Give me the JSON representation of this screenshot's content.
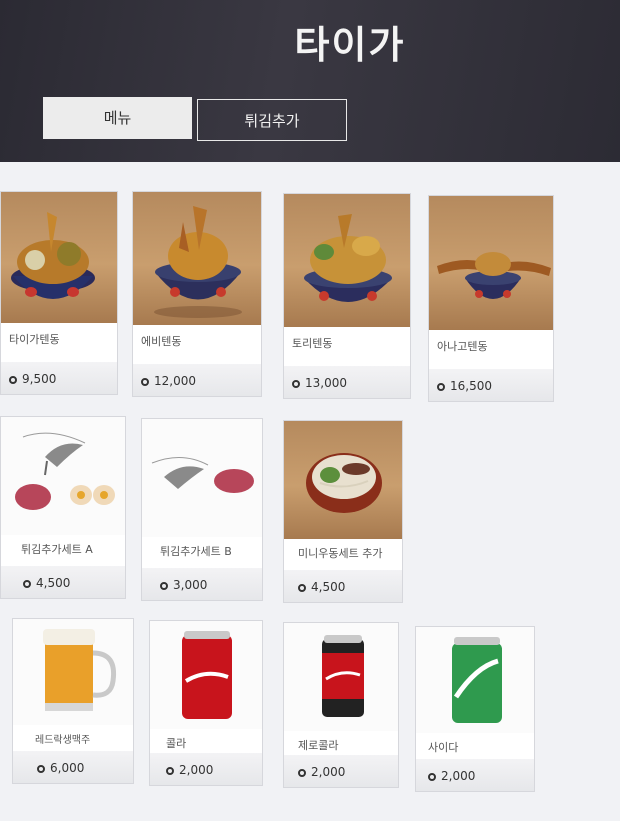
{
  "header": {
    "title": "타이가"
  },
  "tabs": [
    {
      "label": "메뉴"
    },
    {
      "label": "튀김추가"
    }
  ],
  "items": [
    {
      "name": "타이가텐동",
      "price": "9,500",
      "icon": "tempura-bowl"
    },
    {
      "name": "에비텐동",
      "price": "12,000",
      "icon": "shrimp-tempura-bowl"
    },
    {
      "name": "토리텐동",
      "price": "13,000",
      "icon": "chicken-tempura-bowl"
    },
    {
      "name": "아나고텐동",
      "price": "16,500",
      "icon": "eel-tempura-bowl"
    },
    {
      "name": "튀김추가세트 A",
      "price": "4,500",
      "icon": "tempura-set-a"
    },
    {
      "name": "튀김추가세트 B",
      "price": "3,000",
      "icon": "tempura-set-b"
    },
    {
      "name": "미니우동세트 추가",
      "price": "4,500",
      "icon": "udon-bowl"
    },
    {
      "name": "레드락생맥주",
      "price": "6,000",
      "icon": "beer-mug"
    },
    {
      "name": "콜라",
      "price": "2,000",
      "icon": "cola-can"
    },
    {
      "name": "제로콜라",
      "price": "2,000",
      "icon": "zero-cola-can"
    },
    {
      "name": "사이다",
      "price": "2,000",
      "icon": "cider-can"
    }
  ],
  "colors": {
    "header_bg": "#2f2e37",
    "cola_red": "#c8141c",
    "cider_green": "#2f9a4e"
  }
}
